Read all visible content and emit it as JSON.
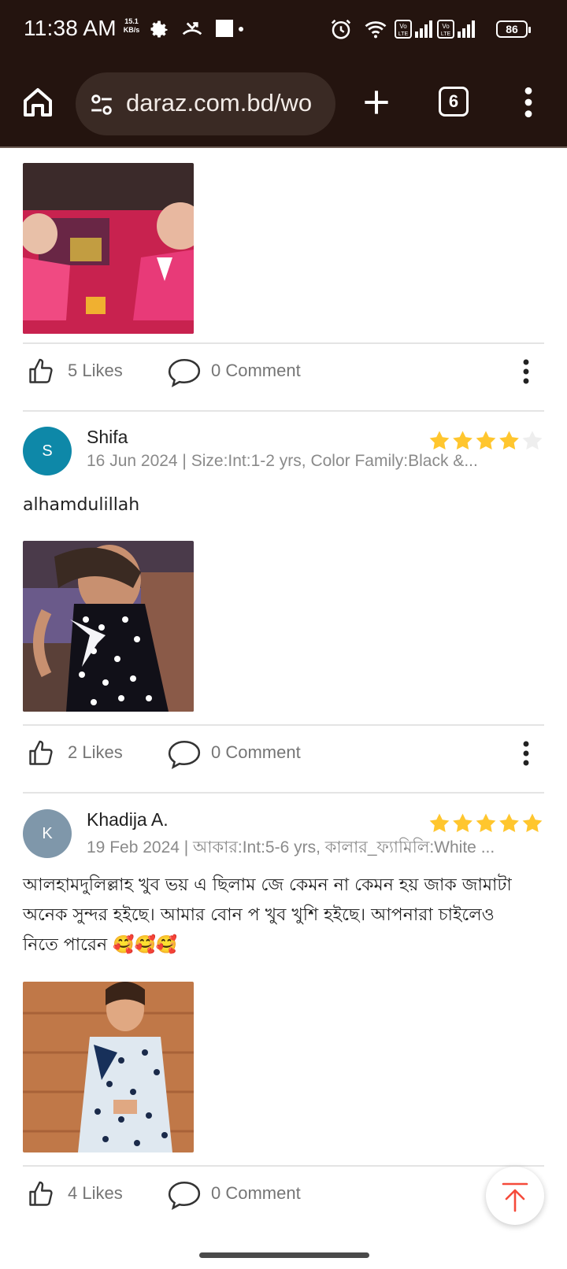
{
  "status_bar": {
    "time": "11:38 AM",
    "speed_value": "15.1",
    "speed_unit": "KB/s",
    "battery": "86"
  },
  "browser": {
    "url": "daraz.com.bd/wo",
    "tab_count": "6"
  },
  "top_post": {
    "likes": "5 Likes",
    "comments": "0 Comment"
  },
  "reviews": [
    {
      "avatar_letter": "S",
      "avatar_color": "#0e88a8",
      "name": "Shifa",
      "rating": 4,
      "meta": "16 Jun 2024 | Size:Int:1-2 yrs, Color Family:Black &...",
      "text": "alhamdulillah",
      "likes": "2 Likes",
      "comments": "0 Comment"
    },
    {
      "avatar_letter": "K",
      "avatar_color": "#7f97aa",
      "name": "Khadija A.",
      "rating": 5,
      "meta": "19 Feb 2024 | আকার:Int:5-6 yrs, কালার_ফ্যামিলি:White ...",
      "text": "আলহামদুলিল্লাহ খুব ভয় এ ছিলাম জে কেমন না কেমন হয়  জাক জামাটা অনেক সুন্দর হইছে। আমার বোন প খুব খুশি হইছে। আপনারা চাইলেও নিতে পারেন 🥰🥰🥰",
      "likes": "4 Likes",
      "comments": "0 Comment"
    }
  ],
  "colors": {
    "browser_bg": "#24140f",
    "star_filled": "#ffc62e",
    "star_empty": "#eeeeee",
    "scroll_top_arrow": "#f54a3a"
  }
}
